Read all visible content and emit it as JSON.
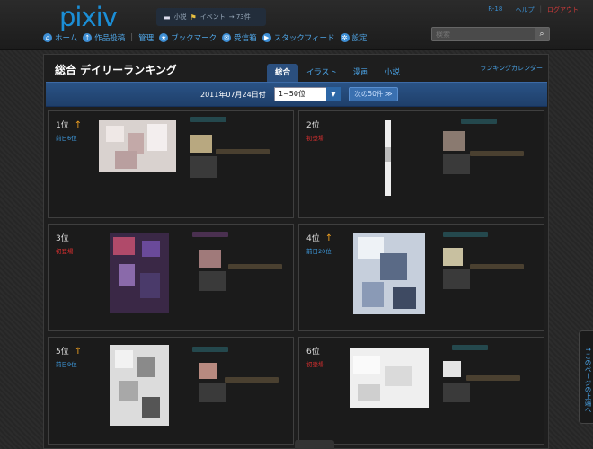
{
  "header": {
    "logo": "pixiv",
    "notice_novel": "小説",
    "notice_event": "イベント",
    "notice_count": "→ 73件",
    "toplinks": [
      "R-18",
      "ヘルプ",
      "ログアウト"
    ],
    "nav": [
      {
        "label": "ホーム",
        "icon": "home-icon"
      },
      {
        "label": "作品投稿",
        "icon": "upload-icon"
      },
      {
        "label": "管理",
        "icon": ""
      },
      {
        "label": "ブックマーク",
        "icon": "star-icon"
      },
      {
        "label": "受信箱",
        "icon": "inbox-icon"
      },
      {
        "label": "スタックフィード",
        "icon": "feed-icon"
      },
      {
        "label": "設定",
        "icon": "gear-icon"
      }
    ],
    "search_placeholder": "検索"
  },
  "panel": {
    "title": "総合 デイリーランキング",
    "tabs": [
      "総合",
      "イラスト",
      "漫画",
      "小説"
    ],
    "active_tab": "総合",
    "calendar_link": "ランキングカレンダー",
    "date": "2011年07月24日付",
    "range_select": "1~50位",
    "next_button": "次の50件 ≫"
  },
  "rankings": [
    {
      "rank": "1位",
      "arrow": "↑",
      "prev": "前日6位"
    },
    {
      "rank": "2位",
      "arrow": "",
      "prev": "初登場"
    },
    {
      "rank": "3位",
      "arrow": "",
      "prev": "初登場"
    },
    {
      "rank": "4位",
      "arrow": "↑",
      "prev": "前日20位"
    },
    {
      "rank": "5位",
      "arrow": "↑",
      "prev": "前日9位"
    },
    {
      "rank": "6位",
      "arrow": "",
      "prev": "初登場"
    }
  ],
  "side_tab": "↑このページの上端へ",
  "colors": {
    "accent": "#3f9fe6",
    "new": "#e03030",
    "up_arrow": "#f0a020"
  }
}
